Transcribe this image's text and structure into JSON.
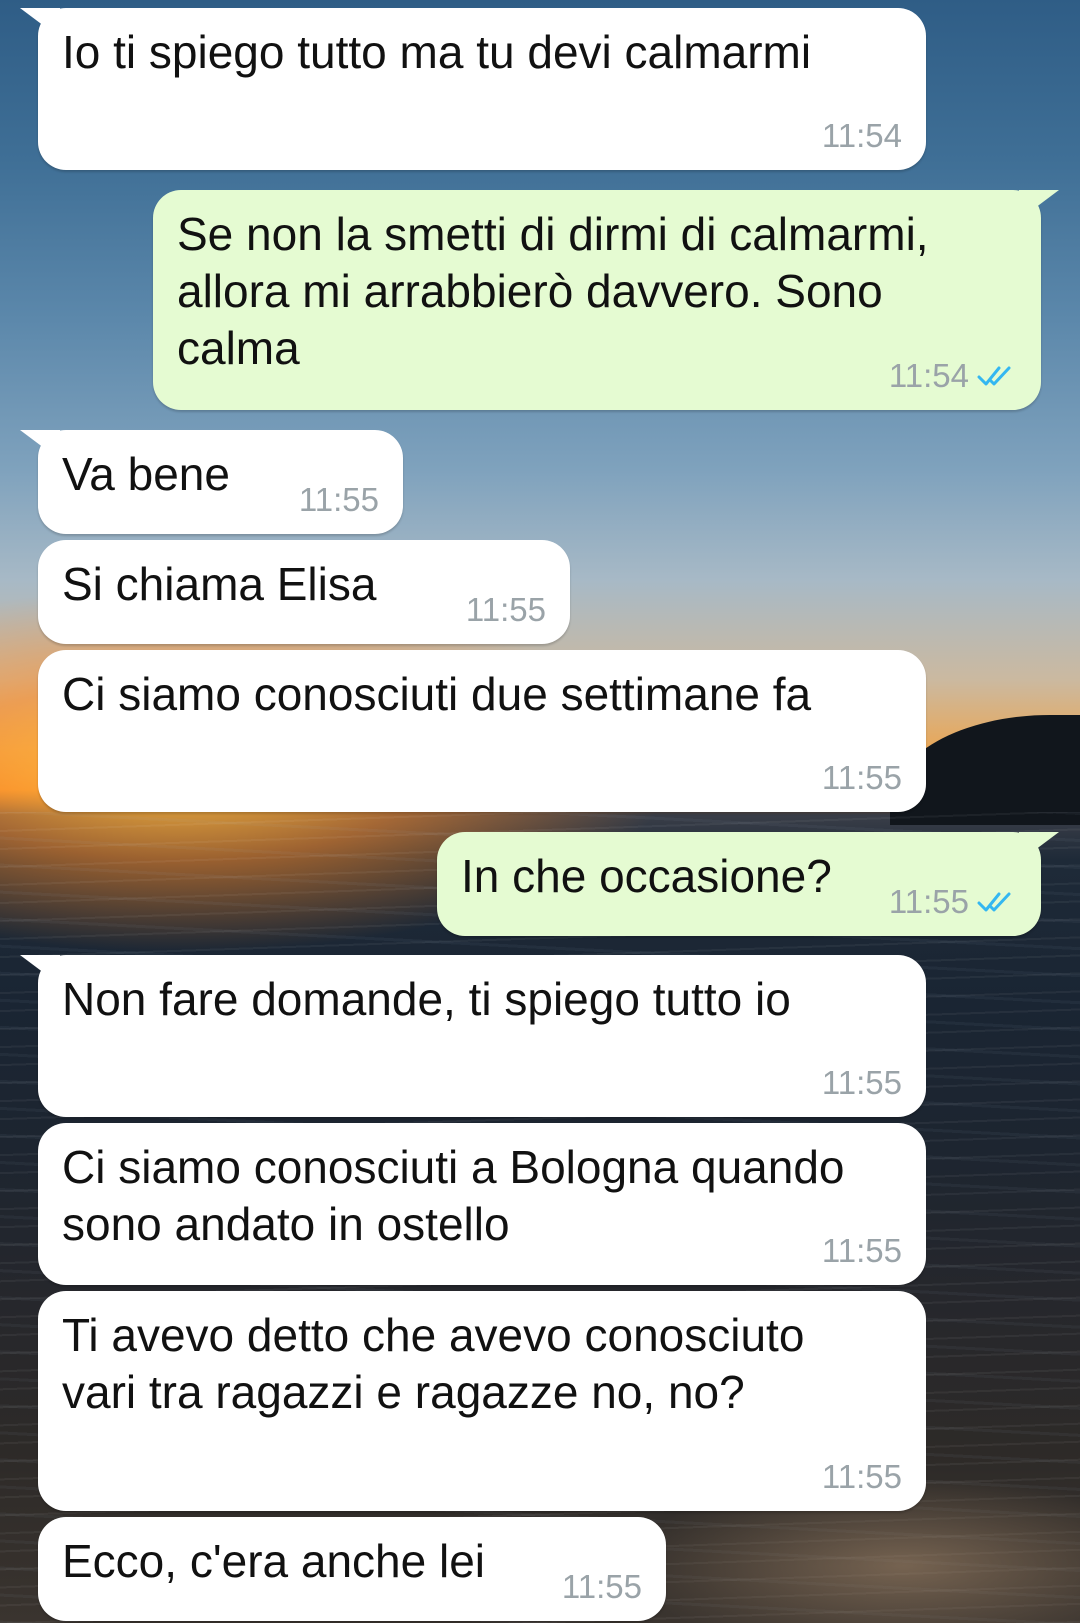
{
  "chat": {
    "messages": [
      {
        "direction": "incoming",
        "text": "Io ti spiego tutto ma tu devi calmarmi",
        "time": "11:54"
      },
      {
        "direction": "outgoing",
        "text": "Se non la smetti di dirmi di calmarmi,\nallora mi arrabbierò davvero. Sono\ncalma",
        "time": "11:54",
        "status": "read"
      },
      {
        "direction": "incoming",
        "text": "Va bene",
        "time": "11:55"
      },
      {
        "direction": "incoming",
        "text": "Si chiama Elisa",
        "time": "11:55"
      },
      {
        "direction": "incoming",
        "text": "Ci siamo conosciuti due settimane fa",
        "time": "11:55"
      },
      {
        "direction": "outgoing",
        "text": "In che occasione?",
        "time": "11:55",
        "status": "read"
      },
      {
        "direction": "incoming",
        "text": "Non fare domande, ti spiego tutto io",
        "time": "11:55"
      },
      {
        "direction": "incoming",
        "text": "Ci siamo conosciuti a Bologna quando\nsono andato in ostello",
        "time": "11:55"
      },
      {
        "direction": "incoming",
        "text": "Ti avevo detto che avevo conosciuto\nvari tra ragazzi e ragazze no, no?",
        "time": "11:55"
      },
      {
        "direction": "incoming",
        "text": "Ecco, c'era anche lei",
        "time": "11:55"
      }
    ]
  },
  "icons": {
    "read_receipt": "double-check-icon"
  },
  "colors": {
    "incoming_bubble": "#ffffff",
    "outgoing_bubble": "#e5fbd2",
    "timestamp": "#9aa3a8",
    "read_ticks": "#34b7f1"
  }
}
